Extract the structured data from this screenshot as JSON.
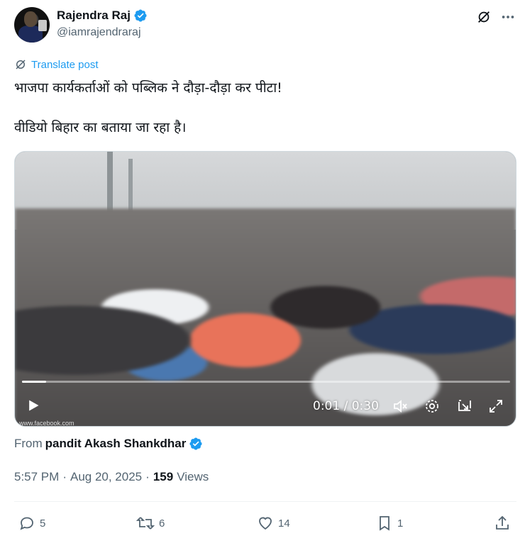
{
  "author": {
    "name": "Rajendra Raj",
    "handle": "@iamrajendraraj"
  },
  "translate_label": "Translate post",
  "tweet": {
    "line1": "भाजपा कार्यकर्ताओं को पब्लिक ने दौड़ा-दौड़ा कर पीटा!",
    "line2": "वीडियो बिहार का बताया जा रहा है।"
  },
  "video": {
    "current_time": "0:01",
    "duration": "0:30",
    "time_display": "0:01 / 0:30",
    "progress_fraction": 0.05,
    "watermark": "www.facebook.com"
  },
  "from": {
    "label": "From",
    "source": "pandit Akash Shankdhar"
  },
  "meta": {
    "time": "5:57 PM",
    "date": "Aug 20, 2025",
    "views_count": "159",
    "views_label": "Views"
  },
  "actions": {
    "replies": "5",
    "reposts": "6",
    "likes": "14",
    "bookmarks": "1"
  },
  "colors": {
    "accent": "#1d9bf0",
    "secondary_text": "#536471",
    "primary_text": "#0f1419"
  }
}
